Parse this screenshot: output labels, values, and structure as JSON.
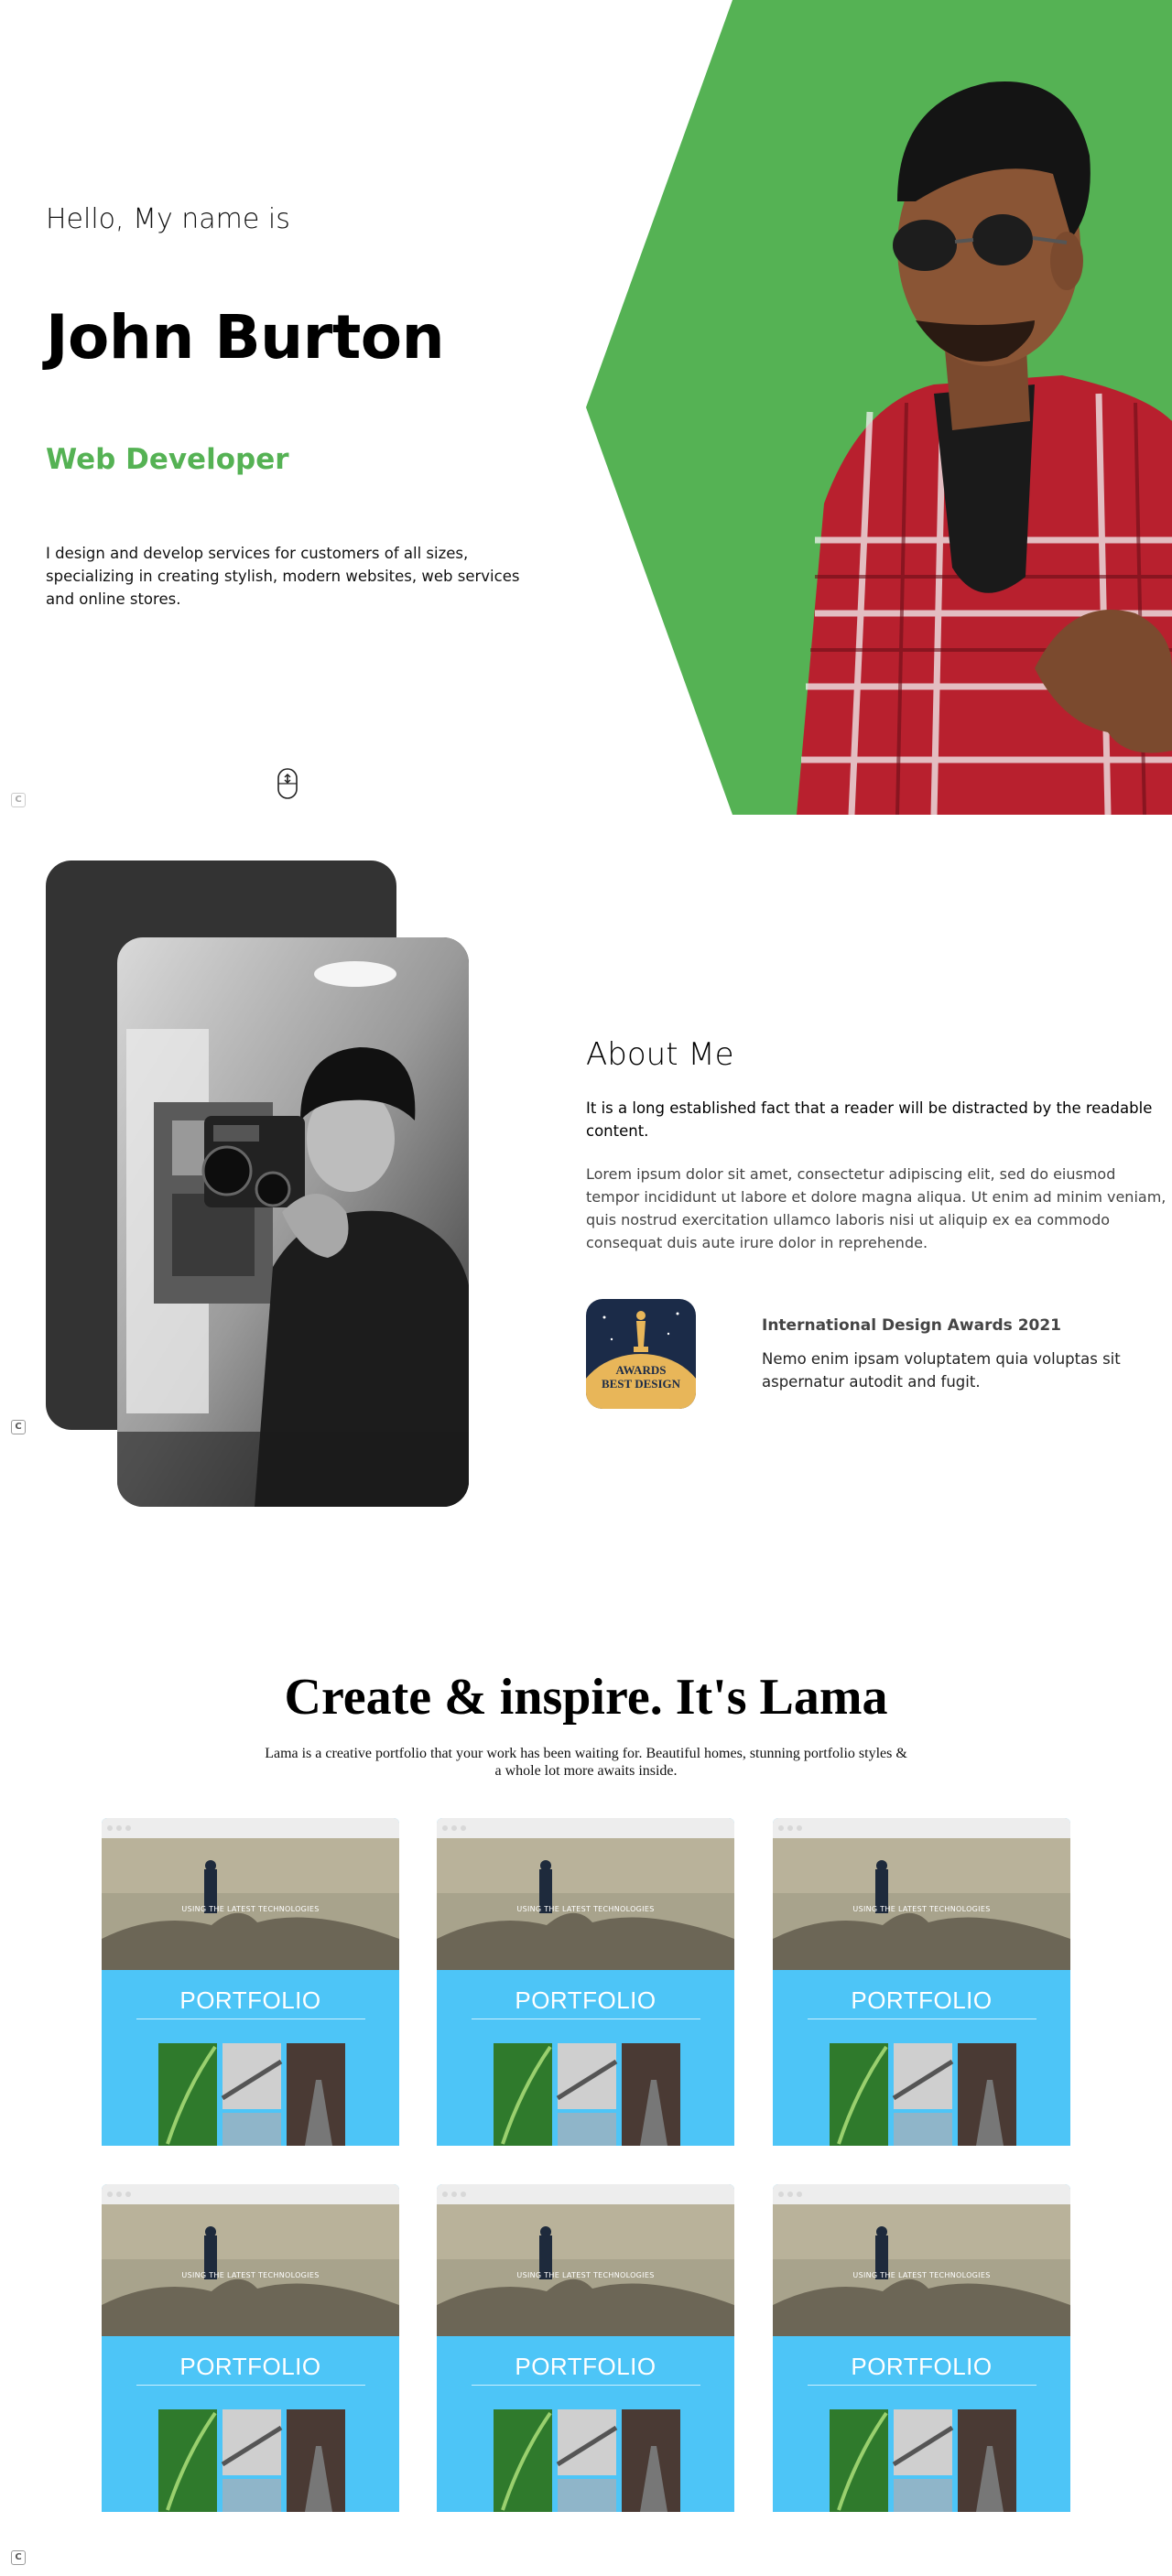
{
  "hero": {
    "greeting": "Hello, My name is",
    "name": "John Burton",
    "role": "Web Developer",
    "description": "I design and develop services for customers of all sizes, specializing in creating stylish, modern websites, web services and online stores."
  },
  "about": {
    "title": "About Me",
    "subtitle": "It is a long established fact that a reader will be distracted by the readable content.",
    "description": "Lorem ipsum dolor sit amet, consectetur adipiscing elit, sed do eiusmod tempor incididunt ut labore et dolore magna aliqua. Ut enim ad minim veniam, quis nostrud exercitation ullamco laboris nisi ut aliquip ex ea commodo consequat duis aute irure dolor in reprehende.",
    "award": {
      "badge_text_1": "AWARDS",
      "badge_text_2": "BEST DESIGN",
      "title": "International Design Awards 2021",
      "description": "Nemo enim ipsam voluptatem quia voluptas sit aspernatur autodit and fugit."
    }
  },
  "portfolio": {
    "title": "Create & inspire. It's Lama",
    "description": "Lama is a creative portfolio that your work has been waiting for. Beautiful homes, stunning portfolio styles & a whole lot more awaits inside.",
    "items": [
      {
        "hero_text": "USING THE LATEST TECHNOLOGIES",
        "label": "PORTFOLIO"
      },
      {
        "hero_text": "USING THE LATEST TECHNOLOGIES",
        "label": "PORTFOLIO"
      },
      {
        "hero_text": "USING THE LATEST TECHNOLOGIES",
        "label": "PORTFOLIO"
      },
      {
        "hero_text": "USING THE LATEST TECHNOLOGIES",
        "label": "PORTFOLIO"
      },
      {
        "hero_text": "USING THE LATEST TECHNOLOGIES",
        "label": "PORTFOLIO"
      },
      {
        "hero_text": "USING THE LATEST TECHNOLOGIES",
        "label": "PORTFOLIO"
      }
    ]
  },
  "side_badge": "C",
  "colors": {
    "accent_green": "#55b254",
    "dark_card": "#333333",
    "portfolio_blue": "#4dc5f7"
  },
  "icons": [
    "mouse-scroll-icon",
    "c-badge-icon"
  ]
}
